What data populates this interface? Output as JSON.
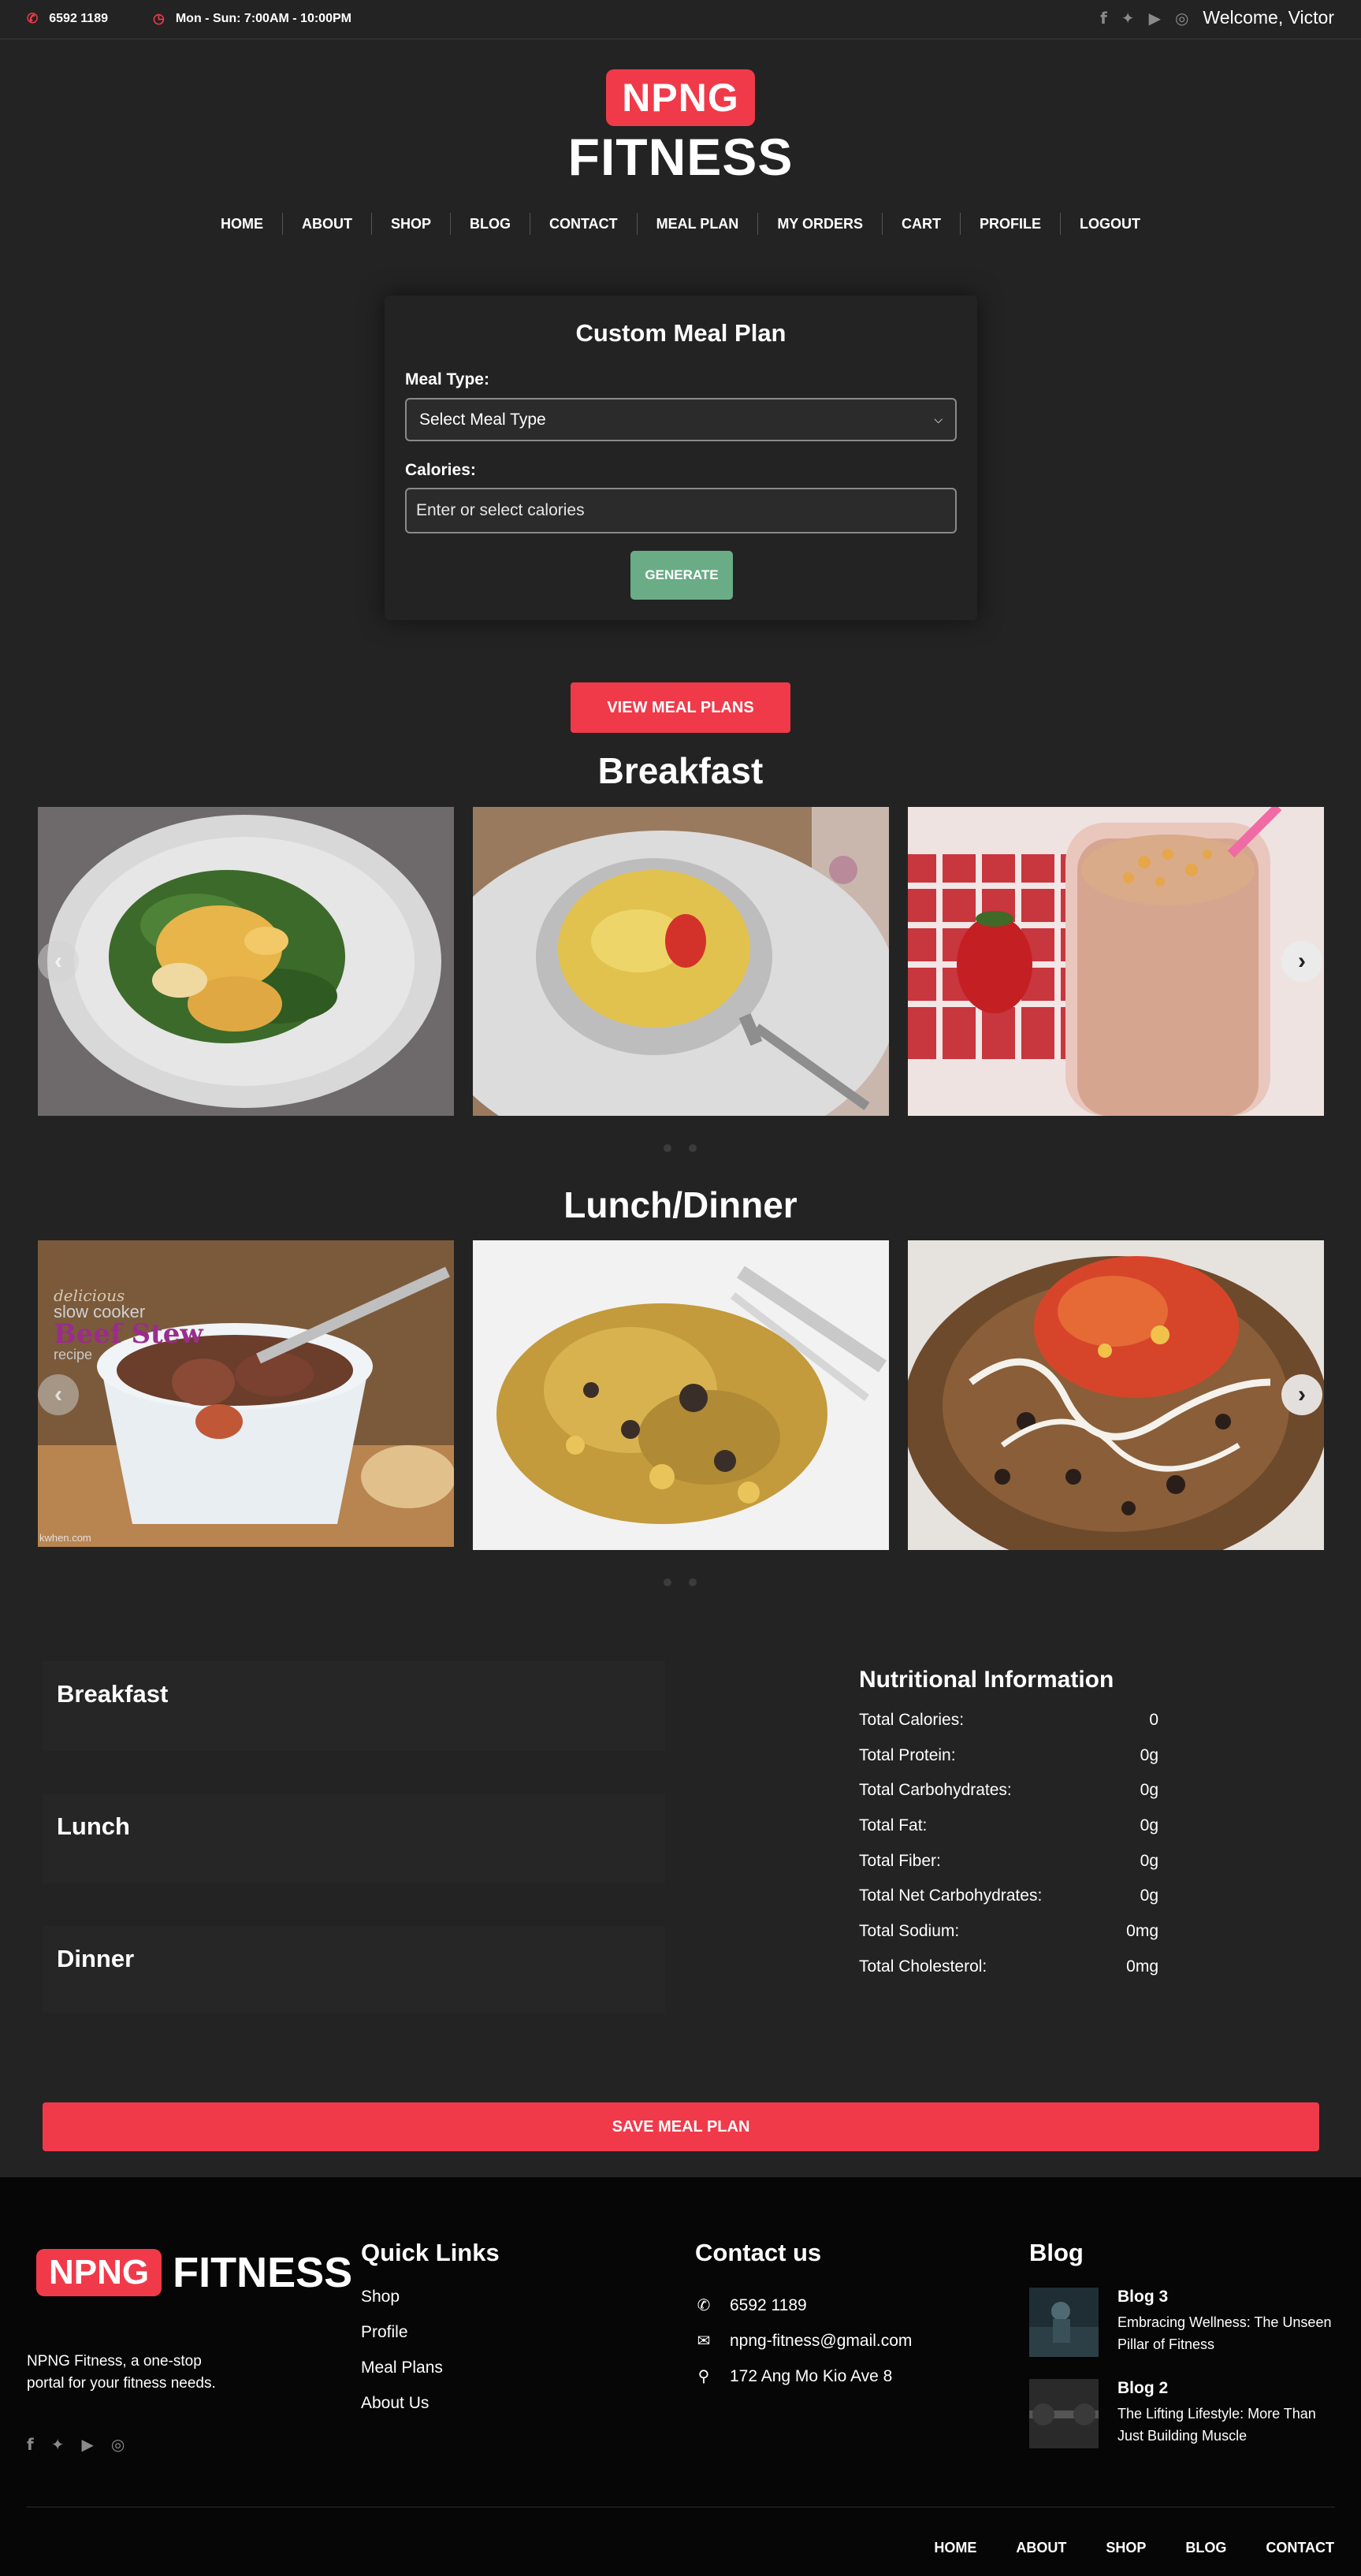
{
  "topbar": {
    "phone": "6592 1189",
    "hours": "Mon - Sun: 7:00AM - 10:00PM",
    "welcome": "Welcome, Victor",
    "social_icons": [
      "facebook-icon",
      "twitter-icon",
      "youtube-icon",
      "instagram-icon"
    ]
  },
  "logo": {
    "badge": "NPNG",
    "word": "FITNESS"
  },
  "nav": [
    "HOME",
    "ABOUT",
    "SHOP",
    "BLOG",
    "CONTACT",
    "MEAL PLAN",
    "MY ORDERS",
    "CART",
    "PROFILE",
    "LOGOUT"
  ],
  "meal_form": {
    "title": "Custom Meal Plan",
    "meal_type_label": "Meal Type:",
    "meal_type_selected": "Select Meal Type",
    "calories_label": "Calories:",
    "calories_placeholder": "Enter or select calories",
    "generate_label": "GENERATE"
  },
  "view_plans_label": "VIEW MEAL PLANS",
  "carousels": {
    "breakfast_title": "Breakfast",
    "lunch_dinner_title": "Lunch/Dinner",
    "beef_stew_text": {
      "line1": "delicious",
      "line2": "slow cooker",
      "line3": "Beef Stew",
      "line4": "recipe",
      "watermark": "kwhen.com"
    }
  },
  "summary": {
    "breakfast": "Breakfast",
    "lunch": "Lunch",
    "dinner": "Dinner"
  },
  "nutrition": {
    "title": "Nutritional Information",
    "rows": [
      {
        "label": "Total Calories:",
        "value": "0"
      },
      {
        "label": "Total Protein:",
        "value": "0g"
      },
      {
        "label": "Total Carbohydrates:",
        "value": "0g"
      },
      {
        "label": "Total Fat:",
        "value": "0g"
      },
      {
        "label": "Total Fiber:",
        "value": "0g"
      },
      {
        "label": "Total Net Carbohydrates:",
        "value": "0g"
      },
      {
        "label": "Total Sodium:",
        "value": "0mg"
      },
      {
        "label": "Total Cholesterol:",
        "value": "0mg"
      }
    ]
  },
  "save_label": "SAVE MEAL PLAN",
  "footer": {
    "badge": "NPNG",
    "word": "FITNESS",
    "about": "NPNG Fitness, a one-stop portal for your fitness needs.",
    "quick_links_title": "Quick Links",
    "quick_links": [
      "Shop",
      "Profile",
      "Meal Plans",
      "About Us"
    ],
    "contact_title": "Contact us",
    "contact": {
      "phone": "6592 1189",
      "email": "npng-fitness@gmail.com",
      "address": "172 Ang Mo Kio Ave 8"
    },
    "blog_title": "Blog",
    "blogs": [
      {
        "name": "Blog 3",
        "desc": "Embracing Wellness: The Unseen Pillar of Fitness"
      },
      {
        "name": "Blog 2",
        "desc": "The Lifting Lifestyle: More Than Just Building Muscle"
      }
    ],
    "bottom_nav": [
      "HOME",
      "ABOUT",
      "SHOP",
      "BLOG",
      "CONTACT"
    ]
  },
  "colors": {
    "accent": "#f03a4a",
    "generate": "#6aac86",
    "background": "#232323",
    "footer": "#060606"
  }
}
